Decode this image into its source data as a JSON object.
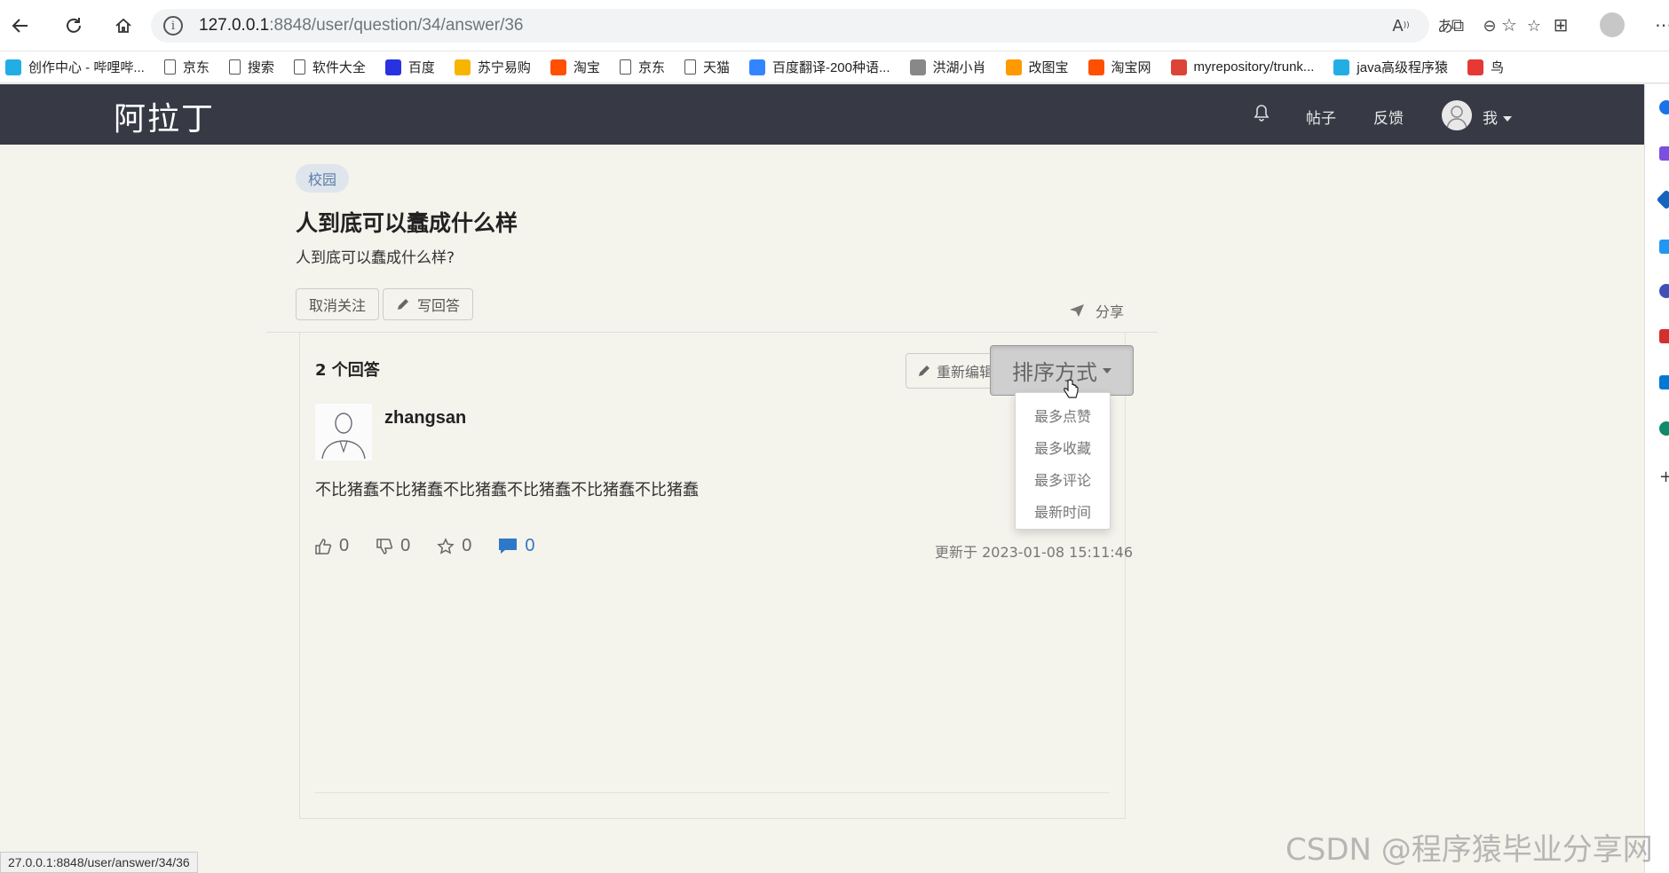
{
  "browser": {
    "url_host": "127.0.0.1",
    "url_path": ":8848/user/question/34/answer/36",
    "status_url": "27.0.0.1:8848/user/answer/34/36"
  },
  "bookmarks": [
    {
      "label": "创作中心 - 哔哩哔...",
      "icon": "bilibili-icon",
      "color": "#23ade5"
    },
    {
      "label": "京东",
      "icon": "page-icon",
      "color": "#555555"
    },
    {
      "label": "搜索",
      "icon": "page-icon",
      "color": "#555555"
    },
    {
      "label": "软件大全",
      "icon": "page-icon",
      "color": "#555555"
    },
    {
      "label": "百度",
      "icon": "baidu-paw-icon",
      "color": "#2932e1"
    },
    {
      "label": "苏宁易购",
      "icon": "suning-icon",
      "color": "#f7b500"
    },
    {
      "label": "淘宝",
      "icon": "taobao-icon",
      "color": "#ff5000"
    },
    {
      "label": "京东",
      "icon": "page-icon",
      "color": "#555555"
    },
    {
      "label": "天猫",
      "icon": "page-icon",
      "color": "#555555"
    },
    {
      "label": "百度翻译-200种语...",
      "icon": "translate-icon",
      "color": "#3385ff"
    },
    {
      "label": "洪湖小肖",
      "icon": "bird-icon",
      "color": "#888888"
    },
    {
      "label": "改图宝",
      "icon": "gaitubao-icon",
      "color": "#ff9900"
    },
    {
      "label": "淘宝网",
      "icon": "taobao-icon",
      "color": "#ff5000"
    },
    {
      "label": "myrepository/trunk...",
      "icon": "chrome-icon",
      "color": "#db4437"
    },
    {
      "label": "java高级程序猿",
      "icon": "bilibili-icon",
      "color": "#23ade5"
    },
    {
      "label": "鸟",
      "icon": "bird-red-icon",
      "color": "#e53935"
    }
  ],
  "header": {
    "logo": "阿拉丁",
    "nav_posts": "帖子",
    "nav_feedback": "反馈",
    "user_menu": "我"
  },
  "question": {
    "tag": "校园",
    "title": "人到底可以蠢成什么样",
    "description": "人到底可以蠢成什么样?",
    "unfollow_label": "取消关注",
    "write_answer_label": "写回答",
    "share_label": "分享"
  },
  "answers": {
    "count_label": "2 个回答",
    "reedit_label": "重新编辑",
    "sort_label": "排序方式",
    "sort_options": [
      "最多点赞",
      "最多收藏",
      "最多评论",
      "最新时间"
    ]
  },
  "answer": {
    "username": "zhangsan",
    "content": "不比猪蠢不比猪蠢不比猪蠢不比猪蠢不比猪蠢不比猪蠢",
    "likes": "0",
    "dislikes": "0",
    "favorites": "0",
    "comments": "0",
    "updated": "更新于 2023-01-08 15:11:46"
  },
  "watermark": "CSDN @程序猿毕业分享网",
  "colors": {
    "header_bg": "#373945",
    "page_bg": "#f4f3ec",
    "comment_accent": "#2e78c8",
    "tag_text": "#5b7da7"
  }
}
